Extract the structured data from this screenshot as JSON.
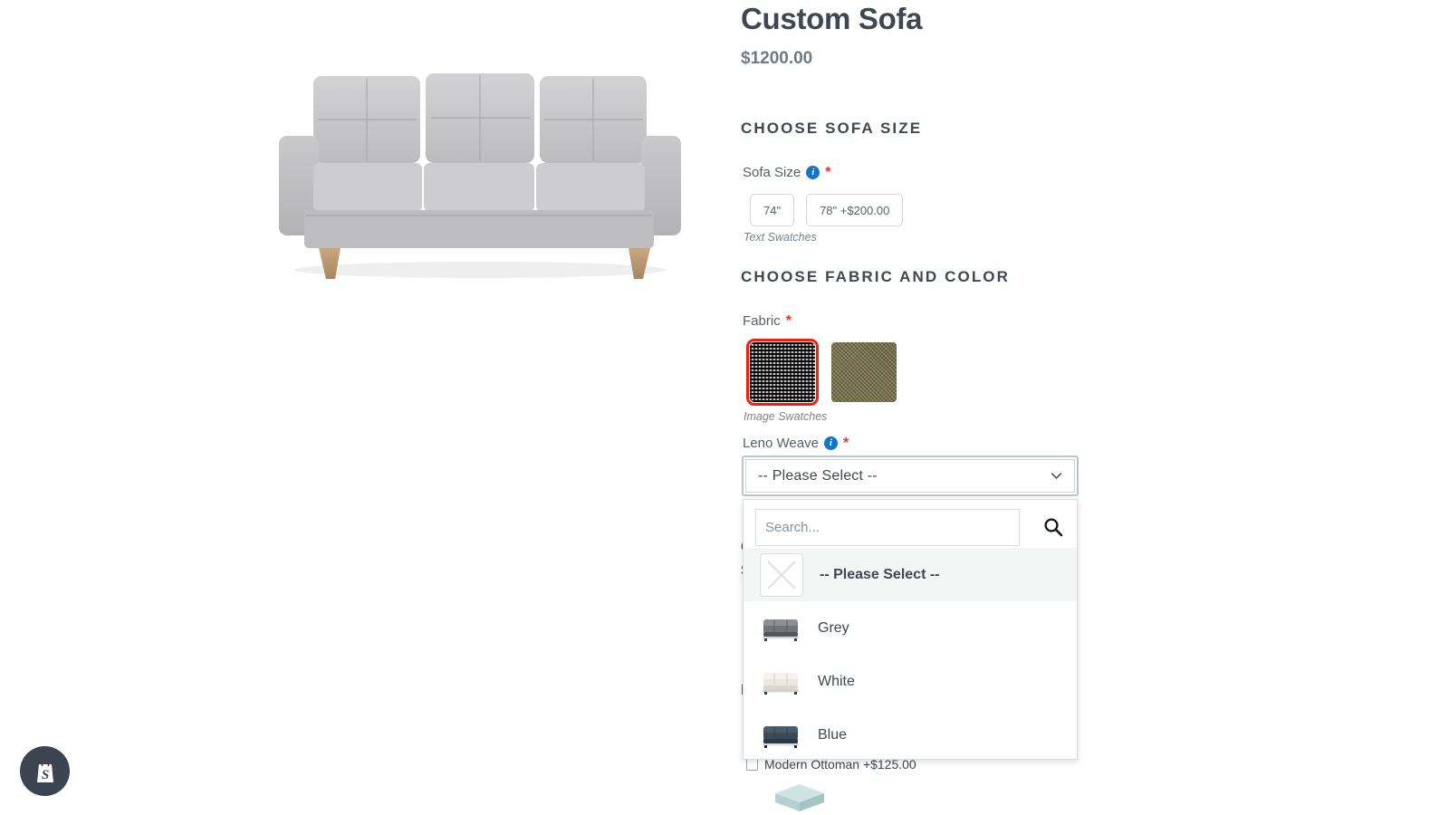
{
  "product": {
    "title": "Custom Sofa",
    "price": "$1200.00",
    "image_alt": "grey-three-seat-sofa"
  },
  "sections": {
    "size_heading": "CHOOSE SOFA SIZE",
    "fabric_heading": "CHOOSE FABRIC AND COLOR",
    "occluded_heading_1": "C",
    "occluded_heading_2": "S",
    "occluded_heading_3": "P"
  },
  "size_field": {
    "label": "Sofa Size",
    "required_mark": "*",
    "info_glyph": "i",
    "note": "Text Swatches",
    "options": [
      {
        "label": "74\"",
        "selected": false
      },
      {
        "label": "78\" +$200.00",
        "selected": false
      }
    ]
  },
  "fabric_field": {
    "label": "Fabric",
    "required_mark": "*",
    "note": "Image Swatches",
    "swatches": [
      {
        "name": "black-white-weave",
        "selected": true,
        "selected_color": "#f71d0b"
      },
      {
        "name": "olive-weave",
        "selected": false
      }
    ]
  },
  "leno_field": {
    "label": "Leno Weave",
    "required_mark": "*",
    "info_glyph": "i",
    "selected_value": "-- Please Select --",
    "focus_ring_color": "#b6c6d6",
    "search_placeholder": "Search...",
    "search_value": "",
    "options": [
      {
        "label": "-- Please Select --",
        "thumb": "empty-placeholder",
        "highlighted": true
      },
      {
        "label": "Grey",
        "thumb": "grey-sofa",
        "highlighted": false
      },
      {
        "label": "White",
        "thumb": "white-sofa",
        "highlighted": false
      },
      {
        "label": "Blue",
        "thumb": "blue-sofa",
        "highlighted": false
      }
    ]
  },
  "addon": {
    "label": "Modern Ottoman +$125.00",
    "checked": false,
    "image_alt": "teal-ottoman"
  },
  "shopify": {
    "name": "shopify-chat-bubble",
    "color": "#3c4450"
  }
}
